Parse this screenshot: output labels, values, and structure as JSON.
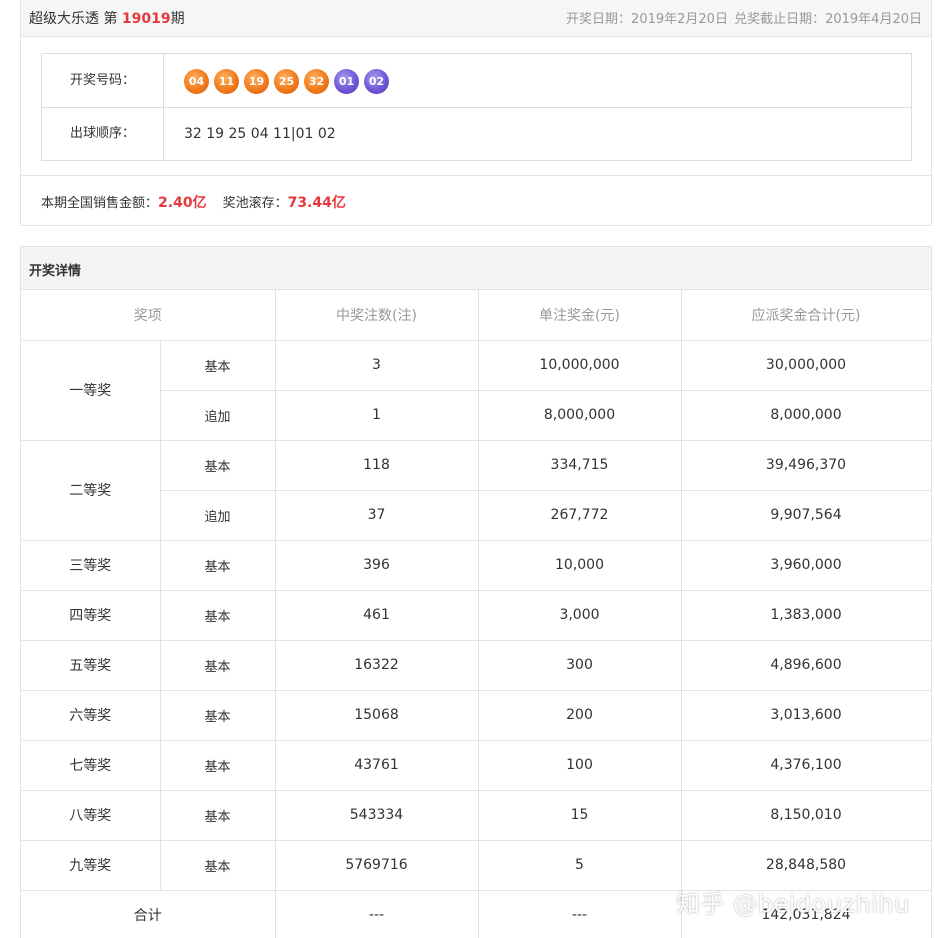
{
  "header": {
    "lottery_name": "超级大乐透 第 ",
    "issue_number": "19019",
    "issue_suffix": "期",
    "draw_date": "开奖日期：2019年2月20日",
    "deadline": "兑奖截止日期：2019年4月20日"
  },
  "draw": {
    "numbers_label": "开奖号码：",
    "red_balls": [
      "04",
      "11",
      "19",
      "25",
      "32"
    ],
    "blue_balls": [
      "01",
      "02"
    ],
    "order_label": "出球顺序：",
    "order_value": "32 19 25 04 11|01 02"
  },
  "sales": {
    "sales_label": "本期全国销售金额：",
    "sales_amount": "2.40亿",
    "pool_label": "奖池滚存：",
    "pool_amount": "73.44亿"
  },
  "details": {
    "title": "开奖详情",
    "headers": [
      "奖项",
      "中奖注数(注)",
      "单注奖金(元)",
      "应派奖金合计(元)"
    ],
    "rows": [
      {
        "level": "一等奖",
        "type": "基本",
        "count": "3",
        "prize": "10,000,000",
        "total": "30,000,000"
      },
      {
        "level": "",
        "type": "追加",
        "count": "1",
        "prize": "8,000,000",
        "total": "8,000,000"
      },
      {
        "level": "二等奖",
        "type": "基本",
        "count": "118",
        "prize": "334,715",
        "total": "39,496,370"
      },
      {
        "level": "",
        "type": "追加",
        "count": "37",
        "prize": "267,772",
        "total": "9,907,564"
      },
      {
        "level": "三等奖",
        "type": "基本",
        "count": "396",
        "prize": "10,000",
        "total": "3,960,000"
      },
      {
        "level": "四等奖",
        "type": "基本",
        "count": "461",
        "prize": "3,000",
        "total": "1,383,000"
      },
      {
        "level": "五等奖",
        "type": "基本",
        "count": "16322",
        "prize": "300",
        "total": "4,896,600"
      },
      {
        "level": "六等奖",
        "type": "基本",
        "count": "15068",
        "prize": "200",
        "total": "3,013,600"
      },
      {
        "level": "七等奖",
        "type": "基本",
        "count": "43761",
        "prize": "100",
        "total": "4,376,100"
      },
      {
        "level": "八等奖",
        "type": "基本",
        "count": "543334",
        "prize": "15",
        "total": "8,150,010"
      },
      {
        "level": "九等奖",
        "type": "基本",
        "count": "5769716",
        "prize": "5",
        "total": "28,848,580"
      }
    ],
    "total_row": {
      "label": "合计",
      "count": "---",
      "prize": "---",
      "total": "142,031,824"
    }
  },
  "watermark": "知乎 @beidouzhihu"
}
